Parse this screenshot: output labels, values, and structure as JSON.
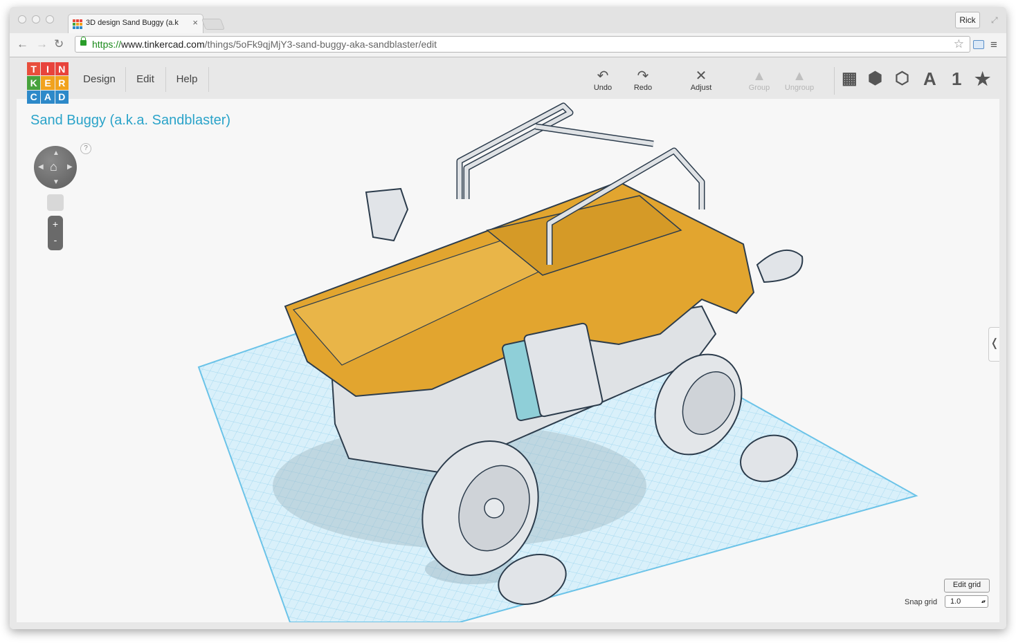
{
  "browser": {
    "tab_title": "3D design Sand Buggy (a.k",
    "tab_close": "×",
    "profile": "Rick",
    "url": {
      "scheme": "https://",
      "host": "www.tinkercad.com",
      "path": "/things/5oFk9qjMjY3-sand-buggy-aka-sandblaster/edit"
    }
  },
  "app": {
    "logo_letters": [
      "T",
      "I",
      "N",
      "K",
      "E",
      "R",
      "C",
      "A",
      "D"
    ],
    "logo_colors": [
      "#e84e3c",
      "#e8433c",
      "#e8433c",
      "#47a23c",
      "#f1a21d",
      "#f1a21d",
      "#2d89c9",
      "#2d89c9",
      "#2d89c9"
    ],
    "menu": [
      "Design",
      "Edit",
      "Help"
    ],
    "tools": {
      "undo": "Undo",
      "redo": "Redo",
      "adjust": "Adjust",
      "group": "Group",
      "ungroup": "Ungroup"
    },
    "view_icons": [
      "grid-view-icon",
      "box-view-icon",
      "wireframe-view-icon",
      "text-shape-icon",
      "number-shape-icon",
      "favorite-star-icon"
    ],
    "view_glyphs": {
      "text": "A",
      "number": "1",
      "star": "★"
    },
    "design_title": "Sand Buggy (a.k.a. Sandblaster)",
    "help": "?",
    "zoom_in": "+",
    "zoom_out": "-",
    "edit_grid": "Edit grid",
    "snap_grid_label": "Snap grid",
    "snap_grid_value": "1.0",
    "side_panel_toggle": "❬",
    "colors": {
      "accent_title": "#2aa3c9",
      "model_orange": "#e2a52f",
      "model_grey": "#dfe2e5",
      "grid_blue": "#a9d9ef",
      "bumper_blue": "#8fcfd8"
    }
  }
}
